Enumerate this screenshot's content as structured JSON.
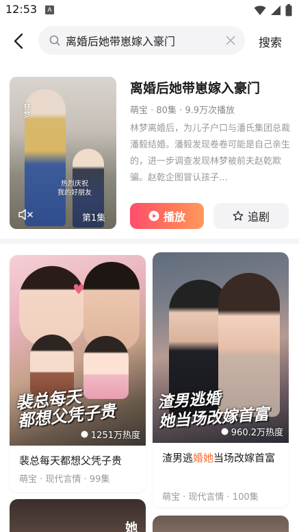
{
  "status_bar": {
    "time": "12:53",
    "notification_badge": "A",
    "icons": [
      "wifi-icon",
      "signal-icon",
      "battery-icon"
    ]
  },
  "search": {
    "query": "离婚后她带崽嫁入豪门",
    "submit_label": "搜索"
  },
  "top_result": {
    "title": "离婚后她带崽嫁入豪门",
    "meta": "萌宝 · 80集 · 9.9万次播放",
    "description": "林梦离婚后，为儿子户口与潘氏集团总裁潘毅结婚。潘毅发现卷卷可能是自己亲生的，进一步调查发现林梦被前夫赵乾欺骗。赵乾企图冒认孩子…",
    "cover_caption": "热烈庆祝\n我的好朋友",
    "cover_name_tag": "林梦",
    "episode_tag": "第1集",
    "play_label": "播放",
    "follow_label": "追剧"
  },
  "cards": [
    {
      "title": "裴总每天都想父凭子贵",
      "title_parts": [
        "裴总每天都想父凭子贵",
        "",
        ""
      ],
      "meta": "萌宝 · 现代言情 · 99集",
      "heat": "1251万热度",
      "cover_art_text": "裴总每天\n都想父凭子贵"
    },
    {
      "title": "渣男逃婚她当场改嫁首富",
      "title_parts": [
        "渣男逃",
        "婚她",
        "当场改嫁首富"
      ],
      "meta": "萌宝 · 现代言情 · 100集",
      "heat": "960.2万热度",
      "cover_art_text": "渣男逃婚\n她当场改嫁首富"
    },
    {
      "peek_text": "她"
    }
  ],
  "colors": {
    "accent_gradient_start": "#ff4d6d",
    "accent_gradient_end": "#ff9a5c",
    "highlight": "#ff6a2c",
    "muted_text": "#999999"
  }
}
